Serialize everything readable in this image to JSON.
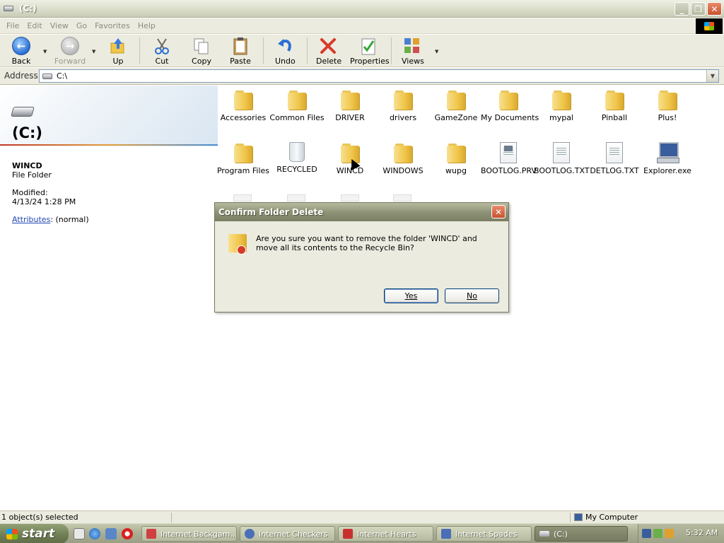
{
  "window": {
    "title": "(C:)",
    "buttons": {
      "minimize": "_",
      "maximize": "❐",
      "close": "✕"
    }
  },
  "menu": {
    "items": [
      "File",
      "Edit",
      "View",
      "Go",
      "Favorites",
      "Help"
    ]
  },
  "toolbar": {
    "back": "Back",
    "forward": "Forward",
    "up": "Up",
    "cut": "Cut",
    "copy": "Copy",
    "paste": "Paste",
    "undo": "Undo",
    "delete": "Delete",
    "properties": "Properties",
    "views": "Views"
  },
  "address": {
    "label": "Address",
    "value": "C:\\"
  },
  "left_panel": {
    "title": "(C:)",
    "selected_name": "WINCD",
    "selected_type": "File Folder",
    "modified_label": "Modified:",
    "modified_value": "4/13/24 1:28 PM",
    "attributes_link": "Attributes",
    "attributes_value": ": (normal)"
  },
  "files": {
    "row1": [
      "Accessories",
      "Common Files",
      "DRIVER",
      "drivers",
      "GameZone",
      "My Documents",
      "mypal",
      "Pinball",
      "Plus!"
    ],
    "row2": [
      "Program Files",
      "RECYCLED",
      "WINCD",
      "WINDOWS",
      "wupg",
      "BOOTLOG.PRV",
      "BOOTLOG.TXT",
      "DETLOG.TXT",
      "Explorer.exe"
    ]
  },
  "dialog": {
    "title": "Confirm Folder Delete",
    "message": "Are you sure you want to remove the folder 'WINCD' and move all its contents to the Recycle Bin?",
    "yes": "Yes",
    "no": "No"
  },
  "status": {
    "selection": "1 object(s) selected",
    "zone": "My Computer"
  },
  "taskbar": {
    "start": "start",
    "tasks": [
      "Internet Backgam...",
      "Internet Checkers",
      "Internet Hearts",
      "Internet Spades",
      "(C:)"
    ],
    "clock": "5:32 AM"
  }
}
